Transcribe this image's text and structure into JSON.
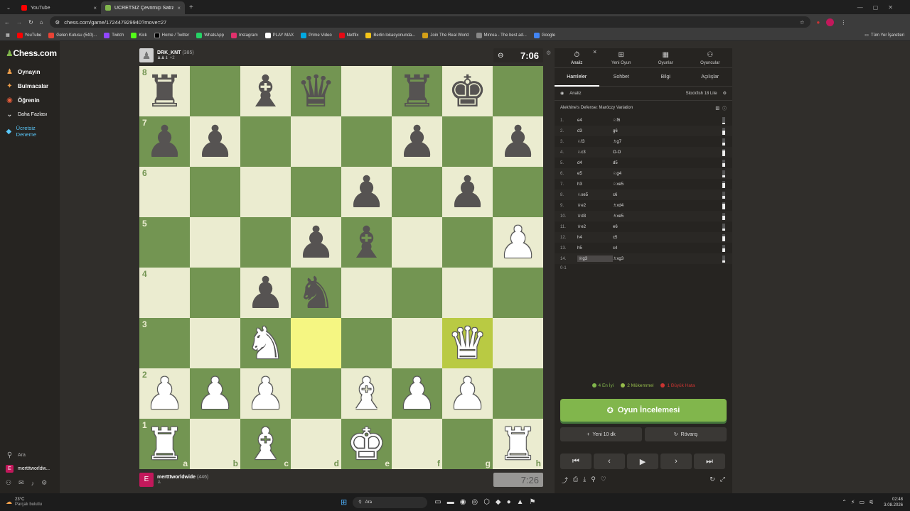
{
  "browser": {
    "tabs": [
      {
        "label": "YouTube",
        "color": "#ff0000"
      },
      {
        "label": "ÜCRETSİZ Çevrimiçi Satranç Oy",
        "color": "#81b64c"
      }
    ],
    "url": "chess.com/game/172447929940?move=27",
    "bookmarks": [
      "YouTube",
      "Gelen Kutusu (540)...",
      "Twitch",
      "Kick",
      "Home / Twitter",
      "WhatsApp",
      "Instagram",
      "PLAY MAX",
      "Prime Video",
      "Netflix",
      "Berlin lokasyonunda...",
      "Join The Real World",
      "Minrea - The best ad...",
      "Google"
    ],
    "bookmarks_right": "Tüm Yer İşaretleri"
  },
  "sidebar": {
    "logo": "Chess.com",
    "items": [
      "Oynayın",
      "Bulmacalar",
      "Öğrenin",
      "Daha Fazlası",
      "Ücretsiz Deneme"
    ],
    "search": "Ara",
    "user": "mertttworldw..."
  },
  "top_player": {
    "name": "DRK_KNT",
    "rating": "(385)",
    "clock": "7:06"
  },
  "bottom_player": {
    "name": "mertttworldwide",
    "rating": "(446)",
    "clock": "7:26"
  },
  "board": {
    "ranks": [
      "8",
      "7",
      "6",
      "5",
      "4",
      "3",
      "2",
      "1"
    ],
    "files": [
      "a",
      "b",
      "c",
      "d",
      "e",
      "f",
      "g",
      "h"
    ],
    "position": [
      [
        "r",
        "",
        "b",
        "q",
        "",
        "r",
        "k",
        ""
      ],
      [
        "p",
        "p",
        "",
        "",
        "",
        "p",
        "",
        "p"
      ],
      [
        "",
        "",
        "",
        "",
        "p",
        "",
        "p",
        ""
      ],
      [
        "",
        "",
        "",
        "p",
        "b",
        "",
        "",
        "P"
      ],
      [
        "",
        "",
        "p",
        "n",
        "",
        "",
        "",
        ""
      ],
      [
        "",
        "",
        "N",
        "",
        "",
        "",
        "Q",
        ""
      ],
      [
        "P",
        "P",
        "P",
        "",
        "B",
        "P",
        "P",
        ""
      ],
      [
        "R",
        "",
        "B",
        "",
        "K",
        "",
        "",
        "R"
      ]
    ],
    "highlight": [
      [
        5,
        3
      ],
      [
        5,
        6
      ]
    ]
  },
  "panel": {
    "tabs": [
      "Analiz",
      "Yeni Oyun",
      "Oyunlar",
      "Oyuncular"
    ],
    "subtabs": [
      "Hamleler",
      "Sohbet",
      "Bilgi",
      "Açılışlar"
    ],
    "analysis_label": "Analiz",
    "engine": "Stockfish 18 Lite",
    "opening": "Alekhine's Defense: Maróczy Variation",
    "moves": [
      [
        "1.",
        "e4",
        "♘f6"
      ],
      [
        "2.",
        "d3",
        "g6"
      ],
      [
        "3.",
        "♘f3",
        "♗g7"
      ],
      [
        "4.",
        "♘c3",
        "O-O"
      ],
      [
        "5.",
        "d4",
        "d5"
      ],
      [
        "6.",
        "e5",
        "♘g4"
      ],
      [
        "7.",
        "h3",
        "♘xe5"
      ],
      [
        "8.",
        "♘xe5",
        "c6"
      ],
      [
        "9.",
        "♕e2",
        "♗xd4"
      ],
      [
        "10.",
        "♕d3",
        "♗xe5"
      ],
      [
        "11.",
        "♕e2",
        "e6"
      ],
      [
        "12.",
        "h4",
        "c5"
      ],
      [
        "13.",
        "h5",
        "c4"
      ],
      [
        "14.",
        "♕g3",
        "♗xg3"
      ]
    ],
    "result": "0-1",
    "summary": [
      {
        "label": "4 En İyi",
        "color": "#81b64c"
      },
      {
        "label": "2 Mükemmel",
        "color": "#96bc4b"
      },
      {
        "label": "1 Büyük Hata",
        "color": "#ca3431"
      }
    ],
    "review": "Oyun İncelemesi",
    "new_game": "Yeni 10 dk",
    "rematch": "Rövanş"
  },
  "taskbar": {
    "weather": "23°C",
    "weather_sub": "Parçalı bulutlu",
    "search": "Ara",
    "time": "02:48",
    "date": "3.08.2026"
  }
}
